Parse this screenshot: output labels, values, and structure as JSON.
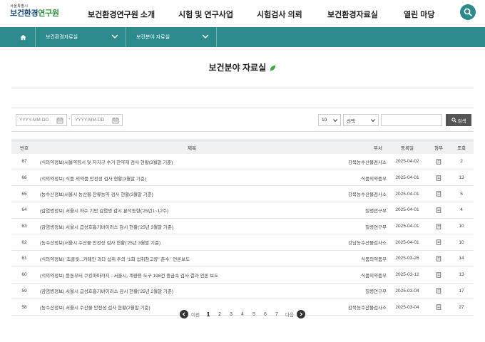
{
  "header": {
    "logo_small": "서울특별시",
    "logo_main_a": "보건환경",
    "logo_main_b": "연구원",
    "nav": [
      "보건환경연구원 소개",
      "시험 및 연구사업",
      "시험검사 의뢰",
      "보건환경자료실",
      "열린 마당"
    ]
  },
  "icons": {
    "search": "search-icon",
    "home": "home-icon",
    "calendar": "calendar-icon",
    "attachment": "document-icon"
  },
  "colors": {
    "accent": "#2d8a8c",
    "logo_blue": "#1f4e7a",
    "logo_green": "#2f8f3f"
  },
  "breadcrumb": {
    "level1": "보건환경자료실",
    "level2": "보건분야 자료실"
  },
  "page": {
    "title": "보건분야 자료실"
  },
  "search": {
    "start_placeholder": "YYYY-MM-DD",
    "end_placeholder": "YYYY-MM-DD",
    "page_size": "10",
    "select_value": "선택",
    "button_label": "검색"
  },
  "table": {
    "headers": {
      "no": "번호",
      "title": "제목",
      "dept": "부서",
      "date": "등록일",
      "file": "첨부",
      "views": "조회"
    },
    "rows": [
      {
        "no": "67",
        "title": "(식의약정보)서울약령시 및 자치구 수거 한약재 검사 현황(3월말 기준)",
        "dept": "강북농수산물검사소",
        "date": "2025-04-02",
        "views": "2"
      },
      {
        "no": "66",
        "title": "(식의약정보) 식품·의약품 안전성 검사 현황(3월말 기준)",
        "dept": "식품의약품부",
        "date": "2025-04-01",
        "views": "13"
      },
      {
        "no": "65",
        "title": "(농수산정보)서울시 농산물 잔류농약 검사 현황(3월말 기준)",
        "dept": "강북농수산물검사소",
        "date": "2025-04-01",
        "views": "5"
      },
      {
        "no": "64",
        "title": "(감염병정보) 서울시 하수 기반 감염병 감시 분석동향('25년1~12주)",
        "dept": "질병연구부",
        "date": "2025-04-01",
        "views": "4"
      },
      {
        "no": "63",
        "title": "(감염병정보) 서울시 급성호흡기바이러스 감시 현황('25년 3월말 기준)",
        "dept": "질병연구부",
        "date": "2025-04-01",
        "views": "10"
      },
      {
        "no": "62",
        "title": "(농수산정보)서울시 수산물 안전성 검사 현황('25년 3월말 기준)",
        "dept": "강남농수산물검사소",
        "date": "2025-04-01",
        "views": "10"
      },
      {
        "no": "61",
        "title": "(식의약정보) '초콜릿...카페인 과다 섭취 주의 \"1회 섭취참고량\" 준수 ' 언론보도",
        "dept": "식품의약품부",
        "date": "2025-03-26",
        "views": "14"
      },
      {
        "no": "60",
        "title": "(식의약정보) 풍동부터 쿠킹마마까지 - 서울시, 계량용 도구 198건 중금속 검사 결과 언론 보도",
        "dept": "식품의약품부",
        "date": "2025-03-12",
        "views": "13"
      },
      {
        "no": "59",
        "title": "(감염병정보) 서울시 급성호흡기바이러스 감시 현황('25년 2월말 기준)",
        "dept": "질병연구부",
        "date": "2025-03-04",
        "views": "17"
      },
      {
        "no": "58",
        "title": "(농수산정보) 서울시 수산물 안전성 검사 현황(2월말 기준)",
        "dept": "강북농수산물검사소",
        "date": "2025-03-04",
        "views": "27"
      }
    ]
  },
  "pagination": {
    "prev_label": "이전",
    "next_label": "다음",
    "pages": [
      "1",
      "2",
      "3",
      "4",
      "5",
      "6",
      "7"
    ],
    "current": "1"
  }
}
